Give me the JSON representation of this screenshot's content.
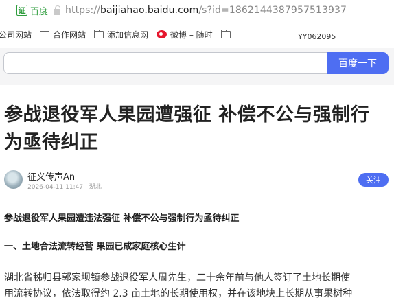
{
  "address_bar": {
    "cert_label": "证",
    "cert_text": "百度",
    "url_scheme": "https://",
    "url_host": "baijiahao.baidu.com",
    "url_path": "/s?id=1862144387957513937"
  },
  "bookmarks": {
    "items": [
      {
        "label": "公司网站",
        "icon": "folder-icon"
      },
      {
        "label": "合作网站",
        "icon": "folder-icon"
      },
      {
        "label": "添加信息网",
        "icon": "folder-icon"
      },
      {
        "label": "微博 – 随时",
        "icon": "weibo-icon"
      },
      {
        "label": "",
        "icon": "folder-icon"
      }
    ],
    "code": "YY062095"
  },
  "search": {
    "placeholder": "",
    "button_label": "百度一下"
  },
  "article": {
    "title_line1": "参战退役军人果园遭强征 补偿不公与强制行",
    "title_line2": "为亟待纠正",
    "author_name": "征义传声An",
    "timestamp": "2026-04-11 11:47",
    "location": "湖北",
    "follow_label": "关注",
    "lead": "参战退役军人果园遭违法强征 补偿不公与强制行为亟待纠正",
    "section_heading": "一、土地合法流转经营 果园已成家庭核心生计",
    "para_line1": "湖北省秭归县郭家坝镇参战退役军人周先生，二十余年前与他人签订了土地长期使",
    "para_line2": "用流转协议，依法取得约 2.3 亩土地的长期使用权，并在该地块上长期从事果树种"
  },
  "colors": {
    "brand_blue": "#4e6ef2",
    "cert_green": "#2e9d3d"
  }
}
